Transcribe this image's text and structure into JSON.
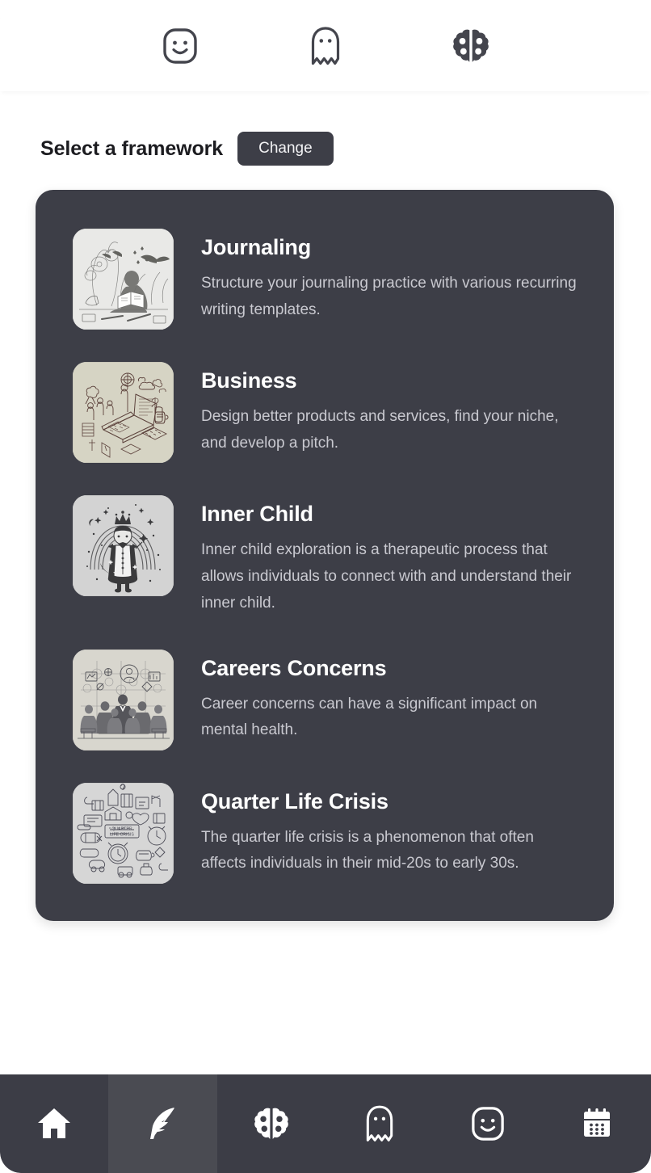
{
  "header": {
    "tabs": [
      {
        "icon": "smiley-face-icon",
        "name": "mood"
      },
      {
        "icon": "ghost-icon",
        "name": "ghost"
      },
      {
        "icon": "brain-icon",
        "name": "brain"
      }
    ]
  },
  "main": {
    "section_title": "Select a framework",
    "change_label": "Change",
    "frameworks": [
      {
        "title": "Journaling",
        "description": "Structure your journaling practice with various recurring writing templates.",
        "thumb": "person-journaling-in-garden-sketch",
        "thumb_bg": "#e8e8e6",
        "thumb_ink": "#6c6c6a"
      },
      {
        "title": "Business",
        "description": "Design better products and services, find your niche, and develop a pitch.",
        "thumb": "laptop-workspace-isometric-sketch",
        "thumb_bg": "#d6d4c4",
        "thumb_ink": "#5c423c"
      },
      {
        "title": "Inner Child",
        "description": "Inner child exploration is a therapeutic process that allows individuals to connect with and understand their inner child.",
        "thumb": "child-with-crown-and-cape-sketch",
        "thumb_bg": "#d2d2d2",
        "thumb_ink": "#3a3a3c"
      },
      {
        "title": "Careers Concerns",
        "description": "Career concerns can have a significant impact on mental health.",
        "thumb": "business-people-crowd-sketch",
        "thumb_bg": "#d7d5cd",
        "thumb_ink": "#4e4e52"
      },
      {
        "title": "Quarter Life Crisis",
        "description": "The quarter life crisis is a phenomenon that often affects individuals in their mid-20s to early 30s.",
        "thumb": "quarter-life-crisis-doodle-collage",
        "thumb_bg": "#d5d5d5",
        "thumb_ink": "#4a4a55"
      }
    ]
  },
  "bottom_nav": {
    "items": [
      {
        "icon": "home-icon",
        "name": "home",
        "active": false
      },
      {
        "icon": "feather-icon",
        "name": "write",
        "active": true
      },
      {
        "icon": "brain-icon",
        "name": "brain",
        "active": false
      },
      {
        "icon": "ghost-icon",
        "name": "ghost",
        "active": false
      },
      {
        "icon": "smiley-face-icon",
        "name": "mood",
        "active": false
      },
      {
        "icon": "calendar-icon",
        "name": "calendar",
        "active": false
      }
    ]
  },
  "colors": {
    "page_bg": "#ffffff",
    "card_bg": "#3d3e47",
    "nav_bg": "#3c3d46",
    "nav_active_bg": "#4a4b52",
    "title_text": "#1c1c20",
    "body_text": "#c9c9d0"
  }
}
